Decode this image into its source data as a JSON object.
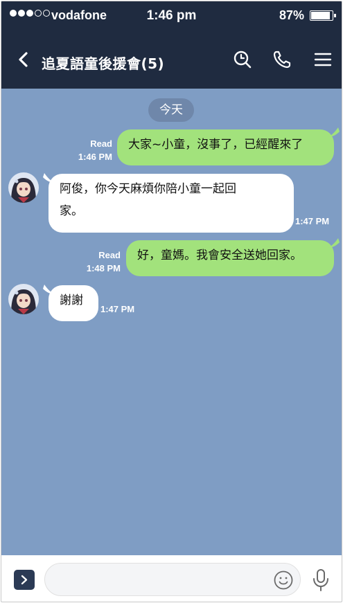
{
  "status_bar": {
    "carrier": "vodafone",
    "time": "1:46 pm",
    "battery": "87%",
    "signal_strength": 3,
    "signal_max": 5
  },
  "header": {
    "title": "追夏語童後援會(5)",
    "icons": [
      "back-icon",
      "search-icon",
      "phone-icon",
      "menu-icon"
    ]
  },
  "chat": {
    "date_separator": "今天",
    "messages": [
      {
        "direction": "outgoing",
        "text": "大家~小童，沒事了，已經醒來了",
        "status": "Read",
        "time": "1:46 PM"
      },
      {
        "direction": "incoming",
        "text_line1": "阿俊，你今天麻煩你陪小童一起回",
        "text_line2": "家。",
        "time": "1:47 PM"
      },
      {
        "direction": "outgoing",
        "text": "好，童媽。我會安全送她回家。",
        "status": "Read",
        "time": "1:48 PM"
      },
      {
        "direction": "incoming",
        "text": "謝謝",
        "time": "1:47 PM"
      }
    ]
  },
  "input_bar": {
    "placeholder": "",
    "icons": [
      "expand-icon",
      "emoji-icon",
      "mic-icon"
    ]
  },
  "colors": {
    "bar_bg": "#1f2b40",
    "chat_bg": "#7f9dc4",
    "outgoing_bubble": "#a2e27c",
    "incoming_bubble": "#ffffff"
  }
}
